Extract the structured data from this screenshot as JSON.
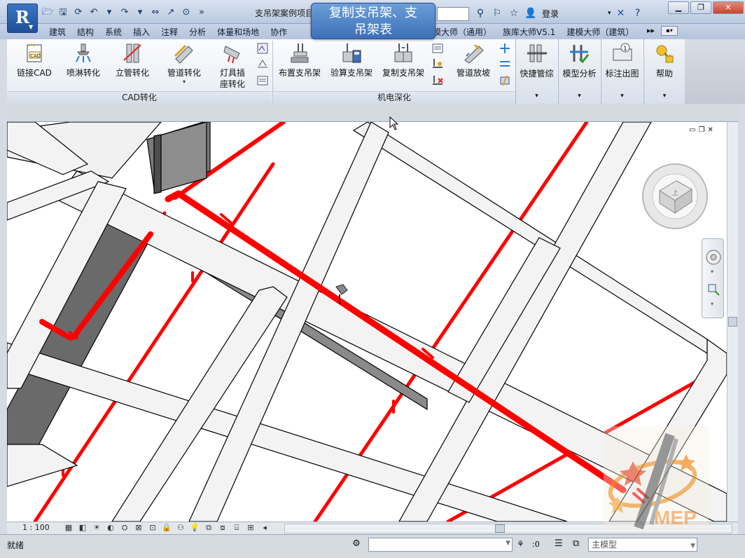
{
  "app": {
    "button_letter": "R",
    "doc_title": "支吊架案例项目"
  },
  "title_tools": {
    "login": "登录"
  },
  "tooltip": {
    "text_line1": "复制支吊架、支",
    "text_line2": "吊架表"
  },
  "tabs": [
    "建筑",
    "结构",
    "系统",
    "插入",
    "注释",
    "分析",
    "体量和场地",
    "协作"
  ],
  "tabs_right": [
    "模大师（通用）",
    "族库大师V5.1",
    "建模大师（建筑）"
  ],
  "ribbon": {
    "cad_panel": {
      "title": "CAD转化",
      "buttons": [
        "链接CAD",
        "喷淋转化",
        "立管转化",
        "管道转化",
        "灯具插\n座转化"
      ]
    },
    "mep_panel": {
      "title": "机电深化",
      "buttons": [
        "布置支吊架",
        "验算支吊架",
        "复制支吊架",
        "管道放坡"
      ]
    },
    "right_panels": [
      "快捷管综",
      "模型分析",
      "标注出图",
      "帮助"
    ]
  },
  "view_control": {
    "scale": "1 : 100"
  },
  "status": {
    "text": "就绪",
    "filter_count": ":0",
    "model_placeholder": "主模型"
  },
  "icons": {
    "app": "revit-logo-icon",
    "nav_wheel": "steering-wheel-icon",
    "view_cube": "view-cube-icon",
    "logo": "mep-logo-icon"
  },
  "colors": {
    "pipe": "#ff0000",
    "beam_top": "#f2f2f2",
    "beam_side": "#6e6e6e",
    "ribbon_accent": "#3d6fb7"
  },
  "watermark": {
    "text": "MEP"
  }
}
